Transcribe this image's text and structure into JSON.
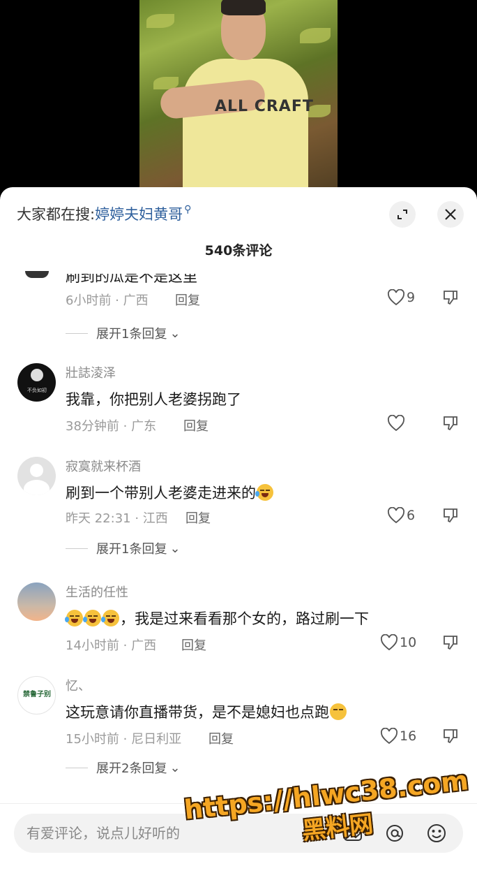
{
  "search": {
    "prefix": "大家都在搜:",
    "term": "婷婷夫妇黄哥"
  },
  "comment_count": "540条评论",
  "video": {
    "shirt_text": "ALL CRAFT"
  },
  "comments": [
    {
      "username": "",
      "text": "刷到的瓜是不是这里",
      "time": "6小时前",
      "location": "广西",
      "reply_label": "回复",
      "likes": "9",
      "expand": "展开1条回复"
    },
    {
      "username": "壯誌淩泽",
      "text": "我靠，你把别人老婆拐跑了",
      "time": "38分钟前",
      "location": "广东",
      "reply_label": "回复",
      "likes": ""
    },
    {
      "username": "寂寞就来杯酒",
      "text": "刷到一个带别人老婆走进来的",
      "time": "昨天 22:31",
      "location": "江西",
      "reply_label": "回复",
      "likes": "6",
      "expand": "展开1条回复"
    },
    {
      "username": "生活的任性",
      "text": "，我是过来看看那个女的，路过刷一下",
      "time": "14小时前",
      "location": "广西",
      "reply_label": "回复",
      "likes": "10"
    },
    {
      "username": "忆、",
      "text": "这玩意请你直播带货，是不是媳妇也点跑",
      "time": "15小时前",
      "location": "尼日利亚",
      "reply_label": "回复",
      "likes": "16",
      "expand": "展开2条回复"
    }
  ],
  "avatar_text": {
    "c2": "不负如初",
    "c5": "禁鲁子别"
  },
  "input": {
    "placeholder": "有爱评论，说点儿好听的"
  },
  "watermark": {
    "url": "https://hlwc38.com",
    "name": "黑料网"
  },
  "colors": {
    "link": "#2e5f9c",
    "watermark": "#f5a623"
  },
  "icons": [
    "expand-icon",
    "close-icon",
    "heart-icon",
    "dislike-icon",
    "image-icon",
    "at-icon",
    "emoji-icon"
  ]
}
